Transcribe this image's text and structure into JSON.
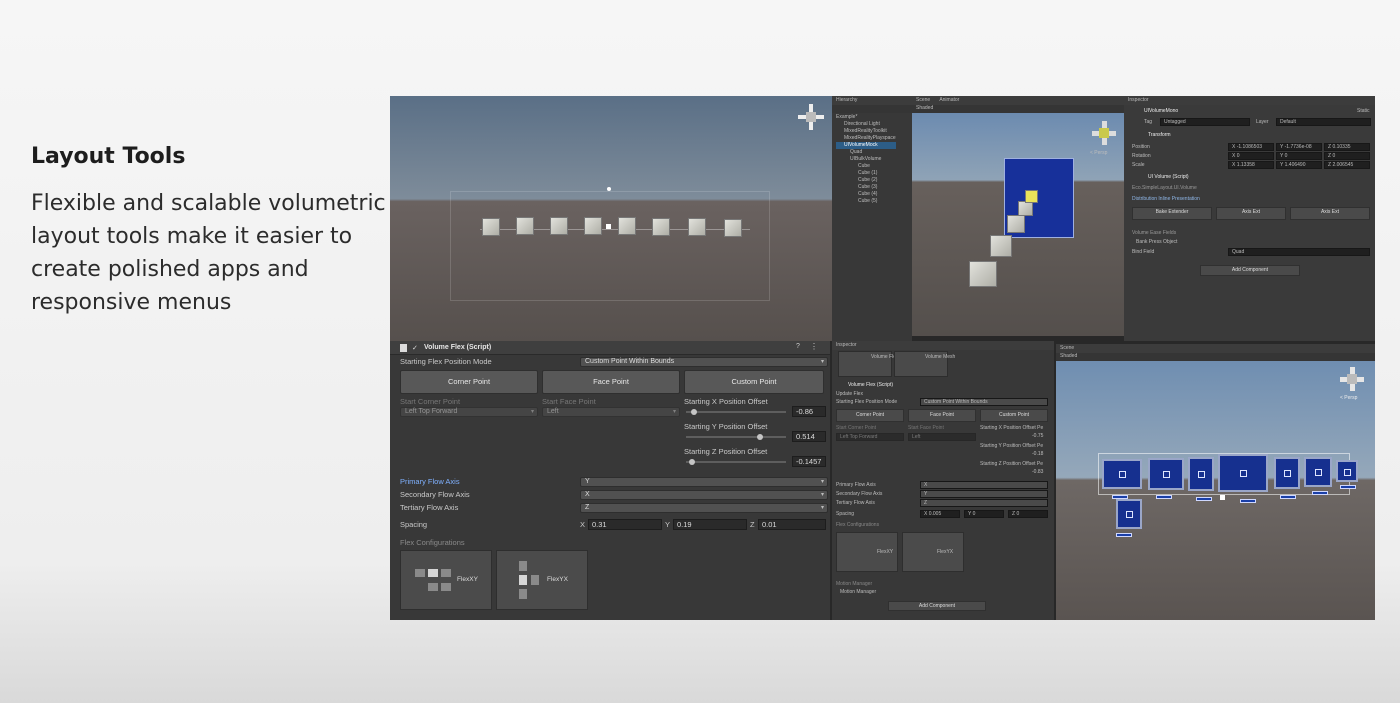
{
  "slide": {
    "title": "Layout Tools",
    "body": "Flexible and scalable volumetric layout tools make it easier to create polished apps and responsive menus"
  },
  "colors": {
    "accent_blue": "#16308f",
    "label_highlight": "#7fb1ff",
    "editor_bg": "#383838"
  },
  "hierarchy": {
    "tab": "Hierarchy",
    "items": [
      "Example*",
      "Directional Light",
      "MixedRealityToolkit",
      "MixedRealityPlayspace",
      "UIVolumeMock",
      "Quad",
      "UIBulkVolume",
      "Cube",
      "Cube (1)",
      "Cube (2)",
      "Cube (3)",
      "Cube (4)",
      "Cube (5)"
    ]
  },
  "scene_tabs": [
    "Scene",
    "Animator"
  ],
  "shading_mode": "Shaded",
  "persp_label": "< Persp",
  "right_inspector": {
    "tab": "Inspector",
    "object_name": "UIVolumeMono",
    "static_label": "Static",
    "tag_label": "Tag",
    "tag_value": "Untagged",
    "layer_label": "Layer",
    "layer_value": "Default",
    "transform_title": "Transform",
    "position_label": "Position",
    "position": [
      "X -1.1086503",
      "Y -1.7736e-08",
      "Z 0.10335"
    ],
    "rotation_label": "Rotation",
    "rotation": [
      "X 0",
      "Y 0",
      "Z 0"
    ],
    "scale_label": "Scale",
    "scale": [
      "X 1.13358",
      "Y 1.406490",
      "Z 2.006545"
    ],
    "script_title": "UI Volume (Script)",
    "script_ref": "Eco.SimpleLayout.UI.Volume",
    "section_title": "Distribution Inline Presentation",
    "buttons": [
      "Bake Extender",
      "Axis Ext",
      "Axis Ext"
    ],
    "sub_title": "Volume Ease Fields",
    "sub_item": "Bank Press Object",
    "bind_label": "Bind Field",
    "bind_value": "Quad",
    "add_component": "Add Component"
  },
  "volume_flex": {
    "title": "Volume Flex (Script)",
    "mode_label": "Starting Flex Position Mode",
    "mode_value": "Custom Point Within Bounds",
    "buttons": [
      "Corner Point",
      "Face Point",
      "Custom Point"
    ],
    "corner_label": "Start Corner Point",
    "corner_value": "Left Top Forward",
    "face_label": "Start Face Point",
    "face_value": "Left",
    "x_offset_label": "Starting X Position Offset",
    "x_offset": "-0.86",
    "y_offset_label": "Starting Y Position Offset",
    "y_offset": "0.514",
    "z_offset_label": "Starting Z Position Offset",
    "z_offset": "-0.1457",
    "x_offset_pct": 0.05,
    "y_offset_pct": 0.75,
    "z_offset_pct": 0.03,
    "primary_label": "Primary Flow Axis",
    "primary_value": "Y",
    "secondary_label": "Secondary Flow Axis",
    "secondary_value": "X",
    "tertiary_label": "Tertiary Flow Axis",
    "tertiary_value": "Z",
    "spacing_label": "Spacing",
    "spacing_x": "0.31",
    "spacing_y": "0.19",
    "spacing_z": "0.01",
    "axis_x": "X",
    "axis_y": "Y",
    "axis_z": "Z",
    "configs_label": "Flex Configurations",
    "configs": [
      "FlexXY",
      "FlexYX"
    ]
  },
  "mini_inspector": {
    "tab": "Inspector",
    "tiles": [
      "Volume Flex",
      "Volume Mesh"
    ],
    "title": "Volume Flex (Script)",
    "update_label": "Update Flex",
    "mode_label": "Starting Flex Position Mode",
    "mode_value": "Custom Point Within Bounds",
    "buttons": [
      "Corner Point",
      "Face Point",
      "Custom Point"
    ],
    "corner_label": "Start Corner Point",
    "corner_value": "Left Top Forward",
    "face_label": "Start Face Point",
    "face_value": "Left",
    "x_offset_label": "Starting X Position Offset Pe",
    "x_offset": "-0.75",
    "y_offset_label": "Starting Y Position Offset Pe",
    "y_offset": "-0.18",
    "z_offset_label": "Starting Z Position Offset Pe",
    "z_offset": "-0.83",
    "primary_label": "Primary Flow Axis",
    "primary_value": "X",
    "secondary_label": "Secondary Flow Axis",
    "secondary_value": "Y",
    "tertiary_label": "Tertiary Flow Axis",
    "tertiary_value": "Z",
    "spacing_label": "Spacing",
    "spacing": [
      "X 0.005",
      "Y 0",
      "Z 0"
    ],
    "configs_label": "Flex Configurations",
    "configs": [
      "FlexXY",
      "FlexYX"
    ],
    "motion_label": "Motion Manager",
    "motion_item": "Motion Manager",
    "add_component": "Add Component"
  },
  "bottom_scene": {
    "tab": "Scene",
    "shading_mode": "Shaded",
    "persp_label": "< Persp"
  }
}
